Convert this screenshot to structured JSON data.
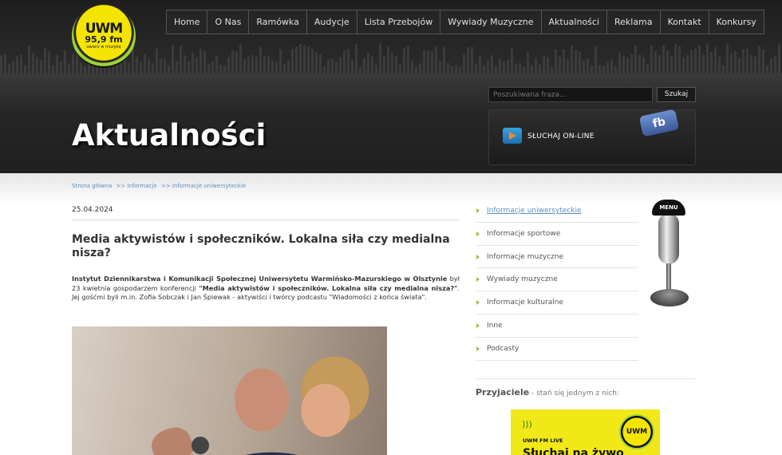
{
  "logo": {
    "line1": "UWM",
    "line2": "95,9 fm",
    "line3": "uwierz w muzykę"
  },
  "nav": [
    {
      "label": "Home"
    },
    {
      "label": "O Nas"
    },
    {
      "label": "Ramówka"
    },
    {
      "label": "Audycje"
    },
    {
      "label": "Lista Przebojów"
    },
    {
      "label": "Wywiady Muzyczne"
    },
    {
      "label": "Aktualności"
    },
    {
      "label": "Reklama"
    },
    {
      "label": "Kontakt"
    },
    {
      "label": "Konkursy"
    }
  ],
  "header": {
    "page_title": "Aktualności",
    "search_placeholder": "Poszukiwana fraza...",
    "search_button": "Szukaj",
    "listen_label": "SŁUCHAJ ON-LINE",
    "fb_label": "fb"
  },
  "breadcrumb": [
    {
      "label": "Strona główna"
    },
    {
      "label": ">> Informacje"
    },
    {
      "label": ">> Informacje uniwersyteckie"
    }
  ],
  "article": {
    "date": "25.04.2024",
    "title": "Media aktywistów i społeczników. Lokalna siła czy medialna nisza?",
    "lead_bold_1": "Instytut Dziennikarstwa i Komunikacji Społecznej Uniwersytetu Warmińsko-Mazurskiego w Olsztynie",
    "lead_text_1": " był 23 kwietnia gospodarzem konferencji ",
    "lead_bold_2": "\"Media aktywistów i społeczników. Lokalna siła czy medialna nisza?\"",
    "lead_text_2": ". Jej gośćmi byli m.in. Zofia Sobczak i Jan Śpiewak - aktywiści i twórcy podcastu \"Wiadomości z końca świata\"."
  },
  "sidebar": {
    "items": [
      {
        "label": "Informacje uniwersyteckie",
        "active": true
      },
      {
        "label": "Informacje sportowe"
      },
      {
        "label": "Informacje muzyczne"
      },
      {
        "label": "Wywiady muzyczne"
      },
      {
        "label": "Informacje kulturalne"
      },
      {
        "label": "Inne"
      },
      {
        "label": "Podcasty"
      }
    ],
    "menu_badge": "MENU",
    "friends_title": "Przyjaciele",
    "friends_subtitle": " - stań się jednym z nich:",
    "promo_live": "UWM FM LIVE",
    "promo_text": "Słuchaj na żywo",
    "promo_logo": "UWM"
  },
  "colors": {
    "accent_link": "#5a8fbf",
    "bullet": "#9bc23a",
    "logo_yellow": "#f3e500"
  }
}
